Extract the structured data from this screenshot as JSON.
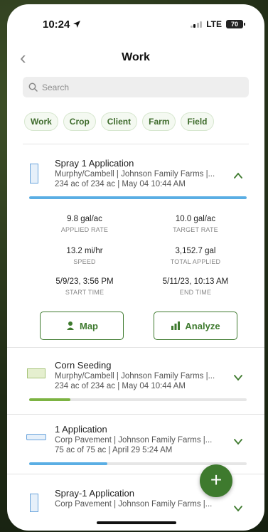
{
  "status_bar": {
    "time": "10:24",
    "network": "LTE",
    "battery": "70"
  },
  "nav": {
    "back_label": "‹",
    "title": "Work"
  },
  "search": {
    "placeholder": "Search"
  },
  "filters": [
    "Work",
    "Crop",
    "Client",
    "Farm",
    "Field"
  ],
  "jobs": [
    {
      "title": "Spray 1 Application",
      "subtitle": "Murphy/Cambell | Johnson Family Farms |...",
      "detail": "234 ac of 234 ac | May 04 10:44 AM",
      "expanded": true,
      "progress": 1.0,
      "progress_color": "#5aaee4"
    },
    {
      "title": "Corn Seeding",
      "subtitle": "Murphy/Cambell | Johnson Family Farms |...",
      "detail": "234 ac of 234 ac | May 04 10:44 AM",
      "expanded": false,
      "progress": 0.19,
      "progress_color": "#7cb342"
    },
    {
      "title": "1 Application",
      "subtitle": "Corp Pavement | Johnson Family Farms |...",
      "detail": "75 ac of 75 ac | April 29 5:24 AM",
      "expanded": false,
      "progress": 0.36,
      "progress_color": "#5aaee4"
    },
    {
      "title": "Spray-1 Application",
      "subtitle": "Corp Pavement | Johnson Family Farms |...",
      "detail": "",
      "expanded": false,
      "progress": null,
      "progress_color": "#5aaee4"
    }
  ],
  "details": {
    "applied_rate": {
      "value": "9.8 gal/ac",
      "label": "APPLIED RATE"
    },
    "target_rate": {
      "value": "10.0 gal/ac",
      "label": "TARGET RATE"
    },
    "speed": {
      "value": "13.2 mi/hr",
      "label": "SPEED"
    },
    "total_applied": {
      "value": "3,152.7 gal",
      "label": "TOTAL APPLIED"
    },
    "start_time": {
      "value": "5/9/23, 3:56 PM",
      "label": "START TIME"
    },
    "end_time": {
      "value": "5/11/23, 10:13 AM",
      "label": "END TIME"
    }
  },
  "actions": {
    "map_label": "Map",
    "analyze_label": "Analyze"
  },
  "fab_label": "+",
  "colors": {
    "brand_green": "#3e7a2e",
    "chip_text": "#3e6b2c",
    "spray_blue": "#5aaee4",
    "seed_green": "#7cb342"
  },
  "icons": {
    "location": "location-arrow-icon",
    "map": "person-pin-icon",
    "analyze": "bar-chart-icon"
  }
}
